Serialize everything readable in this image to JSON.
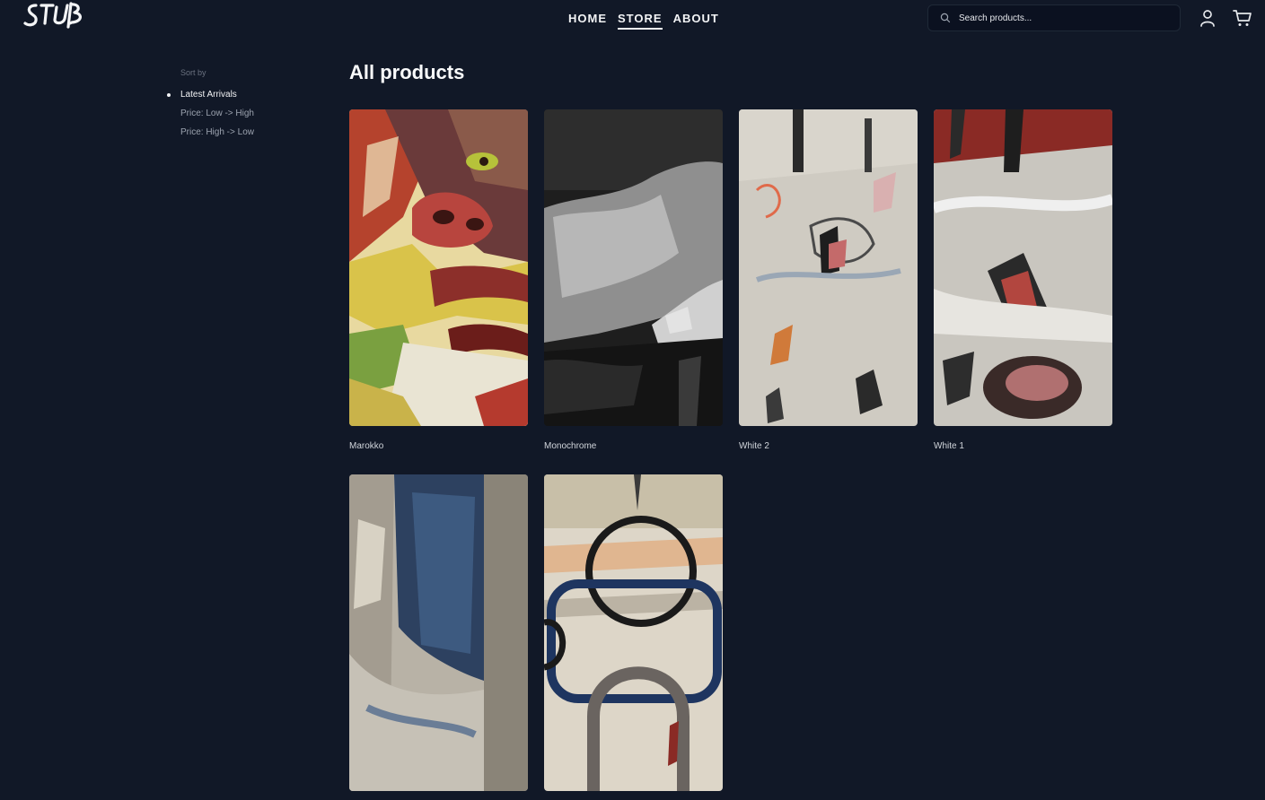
{
  "header": {
    "logo_text": "STUB",
    "nav": [
      {
        "label": "HOME",
        "active": false
      },
      {
        "label": "STORE",
        "active": true
      },
      {
        "label": "ABOUT",
        "active": false
      }
    ],
    "search": {
      "placeholder": "Search products..."
    }
  },
  "sidebar": {
    "sort_label": "Sort by",
    "options": [
      {
        "label": "Latest Arrivals",
        "active": true
      },
      {
        "label": "Price: Low -> High",
        "active": false
      },
      {
        "label": "Price: High -> Low",
        "active": false
      }
    ]
  },
  "main": {
    "title": "All products",
    "products": [
      {
        "title": "Marokko"
      },
      {
        "title": "Monochrome"
      },
      {
        "title": "White 2"
      },
      {
        "title": "White 1"
      },
      {
        "title": ""
      },
      {
        "title": ""
      }
    ]
  },
  "colors": {
    "background": "#111827",
    "text": "#e5e7eb",
    "muted": "#6b7280"
  }
}
